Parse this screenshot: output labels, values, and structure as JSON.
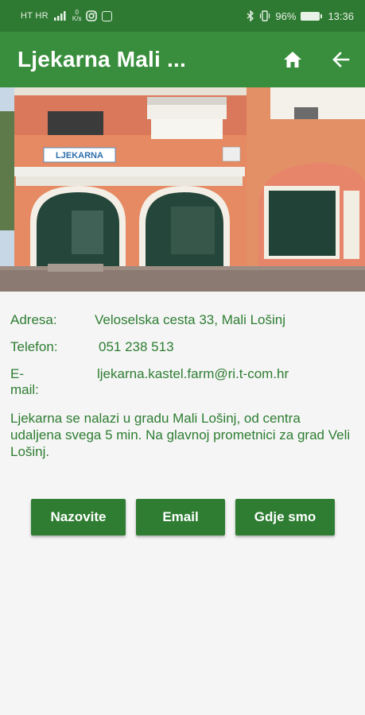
{
  "status_bar": {
    "carrier": "HT HR",
    "net_speed_value": "0",
    "net_speed_unit": "K/s",
    "battery": "96%",
    "time": "13:36",
    "icons": [
      "signal-icon",
      "instagram-icon",
      "gallery-icon",
      "bluetooth-icon",
      "vibrate-icon",
      "battery-icon"
    ]
  },
  "app_bar": {
    "title": "Ljekarna Mali ...",
    "actions": [
      "home-icon",
      "back-arrow-icon"
    ]
  },
  "hero": {
    "sign_text": "LJEKARNA"
  },
  "info": {
    "address_label": "Adresa:",
    "address_value": "Veloselska cesta 33, Mali Lošinj",
    "phone_label": "Telefon:",
    "phone_value": "051 238 513",
    "email_label": "E-mail:",
    "email_value": "ljekarna.kastel.farm@ri.t-com.hr"
  },
  "description": "Ljekarna se nalazi u gradu Mali Lošinj, od centra udaljena svega 5 min. Na glavnoj prometnici za grad Veli Lošinj.",
  "buttons": {
    "call": "Nazovite",
    "email": "Email",
    "location": "Gdje smo"
  },
  "colors": {
    "status_bar": "#2f7a33",
    "app_bar": "#388e3c",
    "text_green": "#2e7d32",
    "button": "#2e7d32",
    "background": "#f5f5f5"
  }
}
